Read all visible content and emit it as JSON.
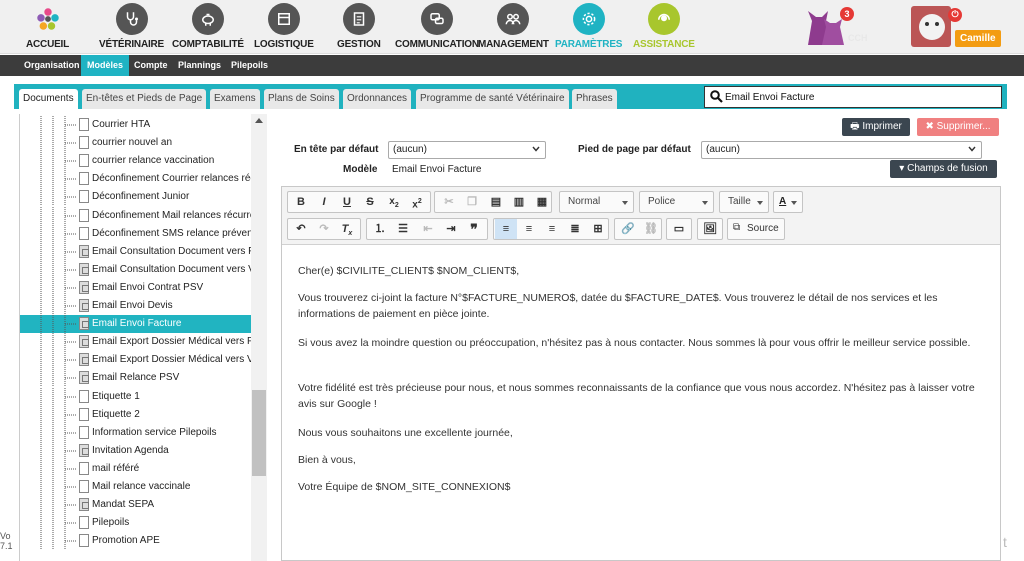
{
  "nav": {
    "items": [
      {
        "label": "ACCUEIL",
        "icon": "flower-logo-icon"
      },
      {
        "label": "VÉTÉRINAIRE",
        "icon": "stethoscope-icon"
      },
      {
        "label": "COMPTABILITÉ",
        "icon": "piggy-bank-icon"
      },
      {
        "label": "LOGISTIQUE",
        "icon": "box-icon"
      },
      {
        "label": "GESTION",
        "icon": "clipboard-icon"
      },
      {
        "label": "COMMUNICATION",
        "icon": "chat-icon"
      },
      {
        "label": "MANAGEMENT",
        "icon": "team-icon"
      },
      {
        "label": "PARAMÈTRES",
        "icon": "gear-icon"
      },
      {
        "label": "ASSISTANCE",
        "icon": "headset-icon"
      }
    ],
    "clinic_badge": "3",
    "clinic_code": "CCH",
    "user_name": "Camille"
  },
  "submenu": [
    "Organisation",
    "Modèles",
    "Compte",
    "Plannings",
    "Pilepoils"
  ],
  "tabs": [
    "Documents",
    "En-têtes et Pieds de Page",
    "Examens",
    "Plans de Soins",
    "Ordonnances",
    "Programme de santé Vétérinaire",
    "Phrases"
  ],
  "search": {
    "value": "Email Envoi Facture"
  },
  "tree": [
    {
      "label": "Courrier HTA",
      "email": false
    },
    {
      "label": "courrier nouvel an",
      "email": false
    },
    {
      "label": "courrier relance vaccination",
      "email": false
    },
    {
      "label": "Déconfinement Courrier relances réc",
      "email": false
    },
    {
      "label": "Déconfinement Junior",
      "email": false
    },
    {
      "label": "Déconfinement Mail relances récurre",
      "email": false
    },
    {
      "label": "Déconfinement SMS relance préven",
      "email": false
    },
    {
      "label": "Email Consultation Document vers F",
      "email": true
    },
    {
      "label": "Email Consultation Document vers V",
      "email": true
    },
    {
      "label": "Email Envoi Contrat PSV",
      "email": true
    },
    {
      "label": "Email Envoi Devis",
      "email": true
    },
    {
      "label": "Email Envoi Facture",
      "email": true,
      "selected": true
    },
    {
      "label": "Email Export Dossier Médical vers P",
      "email": true
    },
    {
      "label": "Email Export Dossier Médical vers V",
      "email": true
    },
    {
      "label": "Email Relance PSV",
      "email": true
    },
    {
      "label": "Etiquette 1",
      "email": false
    },
    {
      "label": "Etiquette 2",
      "email": false
    },
    {
      "label": "Information service Pilepoils",
      "email": false
    },
    {
      "label": "Invitation Agenda",
      "email": true
    },
    {
      "label": "mail référé",
      "email": false
    },
    {
      "label": "Mail relance vaccinale",
      "email": false
    },
    {
      "label": "Mandat SEPA",
      "email": true
    },
    {
      "label": "Pilepoils",
      "email": false
    },
    {
      "label": "Promotion APE",
      "email": false
    }
  ],
  "actions": {
    "print": "Imprimer",
    "delete": "Supprimer...",
    "merge_fields": "Champs de fusion"
  },
  "form": {
    "header_label": "En tête par défaut",
    "header_value": "(aucun)",
    "footer_label": "Pied de page par défaut",
    "footer_value": "(aucun)",
    "model_label": "Modèle",
    "model_value": "Email Envoi Facture"
  },
  "toolbar": {
    "format": "Normal",
    "font": "Police",
    "size": "Taille",
    "source": "Source"
  },
  "content": [
    "Cher(e) $CIVILITE_CLIENT$ $NOM_CLIENT$,",
    "Vous trouverez ci-joint la facture N°$FACTURE_NUMERO$, datée du $FACTURE_DATE$. Vous trouverez le détail de nos services et les informations de paiement en pièce jointe.",
    "Si vous avez la moindre question ou préoccupation, n'hésitez pas à nous contacter. Nous sommes là pour vous offrir le meilleur service possible.",
    "Votre fidélité est très précieuse pour nous, et nous sommes reconnaissants de la confiance que vous nous accordez. N'hésitez pas à laisser votre avis sur Google !",
    "Nous vous souhaitons une excellente journée,",
    "Bien à vous,",
    "Votre Équipe de $NOM_SITE_CONNEXION$"
  ],
  "edge": {
    "left_top": "Vo",
    "left_bottom": "7.1",
    "right": "t"
  },
  "colors": {
    "accent": "#1fb3c3",
    "assist": "#a8c62d",
    "delete": "#f08080",
    "dark": "#3c3c3c"
  }
}
